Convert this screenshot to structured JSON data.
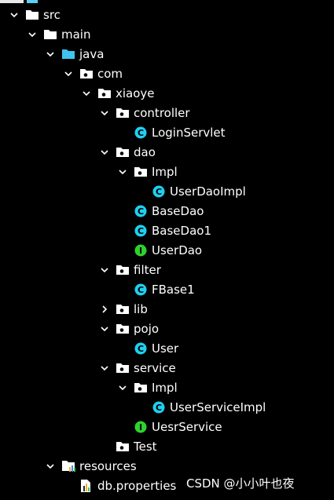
{
  "tree": [
    {
      "label": "src",
      "depth": 0,
      "chevron": "down",
      "icon": "folder-icon",
      "type": "folder"
    },
    {
      "label": "main",
      "depth": 1,
      "chevron": "down",
      "icon": "folder-icon",
      "type": "folder"
    },
    {
      "label": "java",
      "depth": 2,
      "chevron": "down",
      "icon": "source-folder-icon",
      "type": "source"
    },
    {
      "label": "com",
      "depth": 3,
      "chevron": "down",
      "icon": "package-icon",
      "type": "package"
    },
    {
      "label": "xiaoye",
      "depth": 4,
      "chevron": "down",
      "icon": "package-icon",
      "type": "package"
    },
    {
      "label": "controller",
      "depth": 5,
      "chevron": "down",
      "icon": "package-icon",
      "type": "package"
    },
    {
      "label": "LoginServlet",
      "depth": 6,
      "chevron": "none",
      "icon": "class-icon",
      "type": "class"
    },
    {
      "label": "dao",
      "depth": 5,
      "chevron": "down",
      "icon": "package-icon",
      "type": "package"
    },
    {
      "label": "Impl",
      "depth": 6,
      "chevron": "down",
      "icon": "package-icon",
      "type": "package"
    },
    {
      "label": "UserDaoImpl",
      "depth": 7,
      "chevron": "none",
      "icon": "class-icon",
      "type": "class"
    },
    {
      "label": "BaseDao",
      "depth": 6,
      "chevron": "none",
      "icon": "class-icon",
      "type": "class"
    },
    {
      "label": "BaseDao1",
      "depth": 6,
      "chevron": "none",
      "icon": "class-icon",
      "type": "class"
    },
    {
      "label": "UserDao",
      "depth": 6,
      "chevron": "none",
      "icon": "interface-icon",
      "type": "interface"
    },
    {
      "label": "filter",
      "depth": 5,
      "chevron": "down",
      "icon": "package-icon",
      "type": "package"
    },
    {
      "label": "FBase1",
      "depth": 6,
      "chevron": "none",
      "icon": "class-icon",
      "type": "class"
    },
    {
      "label": "lib",
      "depth": 5,
      "chevron": "right",
      "icon": "package-icon",
      "type": "package"
    },
    {
      "label": "pojo",
      "depth": 5,
      "chevron": "down",
      "icon": "package-icon",
      "type": "package"
    },
    {
      "label": "User",
      "depth": 6,
      "chevron": "none",
      "icon": "class-icon",
      "type": "class"
    },
    {
      "label": "service",
      "depth": 5,
      "chevron": "down",
      "icon": "package-icon",
      "type": "package"
    },
    {
      "label": "Impl",
      "depth": 6,
      "chevron": "down",
      "icon": "package-icon",
      "type": "package"
    },
    {
      "label": "UserServiceImpl",
      "depth": 7,
      "chevron": "none",
      "icon": "class-icon",
      "type": "class"
    },
    {
      "label": "UesrService",
      "depth": 6,
      "chevron": "none",
      "icon": "interface-icon",
      "type": "interface"
    },
    {
      "label": "Test",
      "depth": 5,
      "chevron": "none",
      "icon": "package-icon",
      "type": "package"
    },
    {
      "label": "resources",
      "depth": 2,
      "chevron": "down",
      "icon": "resources-folder-icon",
      "type": "resources"
    },
    {
      "label": "db.properties",
      "depth": 3,
      "chevron": "none",
      "icon": "properties-file-icon",
      "type": "properties"
    }
  ],
  "watermark": "CSDN @小小叶也夜",
  "colors": {
    "background": "#000000",
    "text": "#ffffff",
    "class_icon": "#1fd0f0",
    "interface_icon": "#2fd12f",
    "source_folder": "#3fc3ef",
    "resources_bar_1": "#e8b43a",
    "resources_bar_2": "#3a8fe0",
    "resources_bar_3": "#45c060"
  }
}
